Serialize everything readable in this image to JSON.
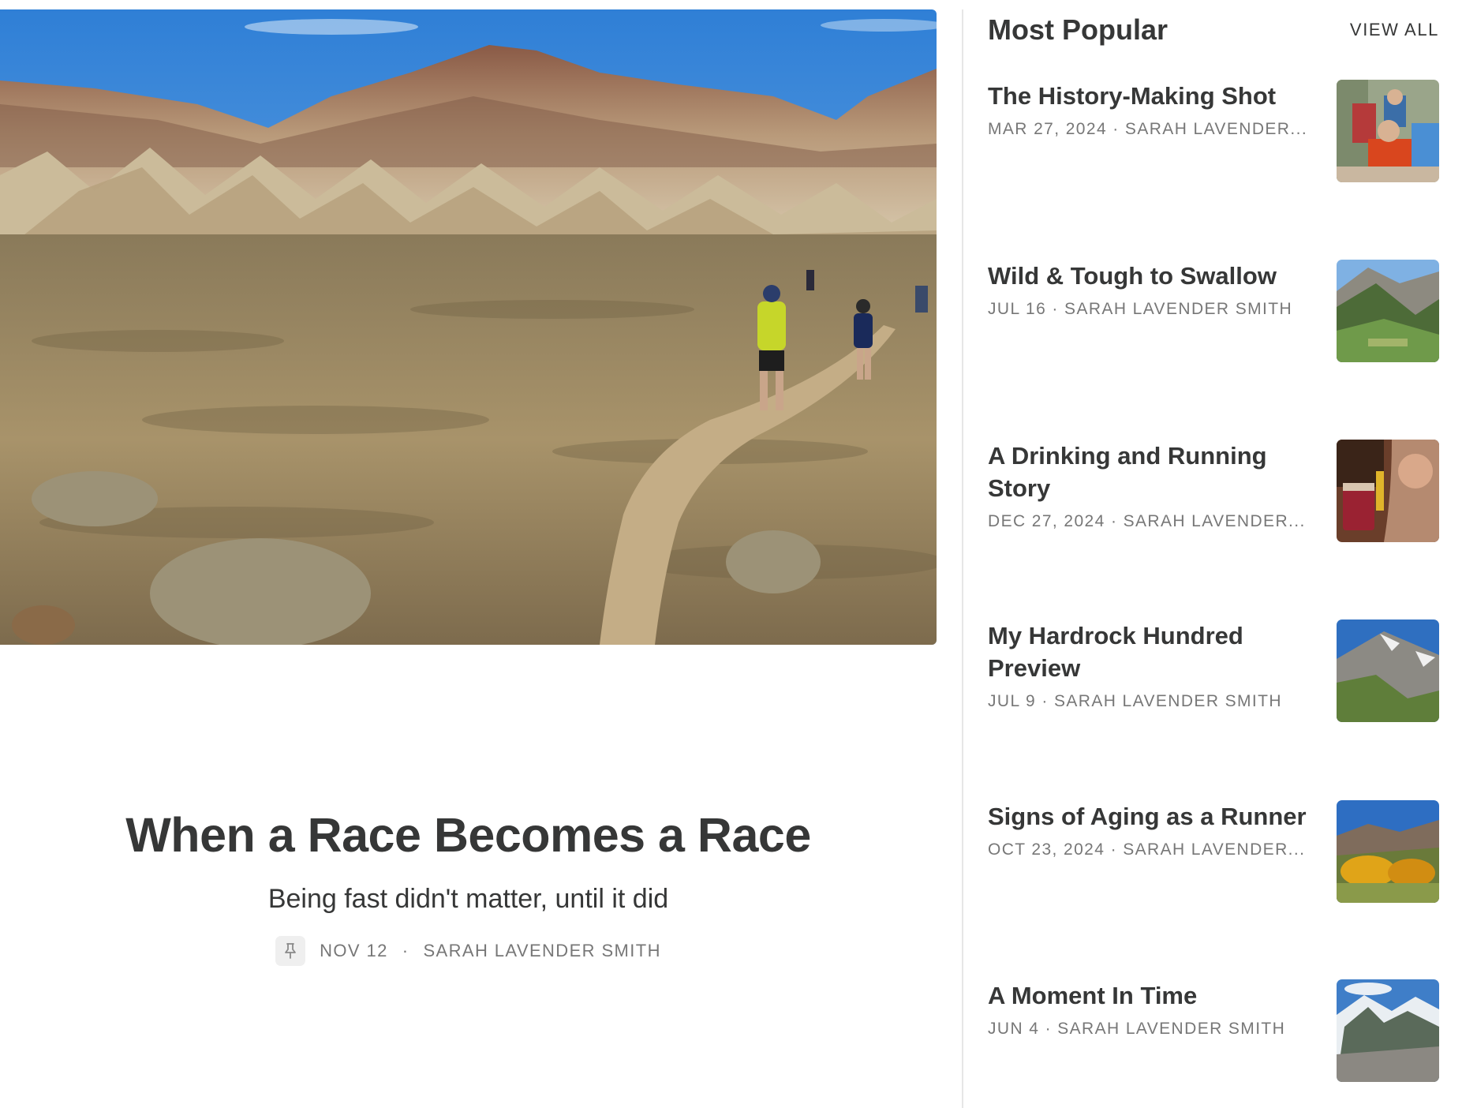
{
  "featured": {
    "title": "When a Race Becomes a Race",
    "subtitle": "Being fast didn't matter, until it did",
    "date": "NOV 12",
    "author": "SARAH LAVENDER SMITH",
    "separator": "·",
    "pin_icon": "pin-icon"
  },
  "sidebar": {
    "heading": "Most Popular",
    "view_all": "VIEW ALL",
    "items": [
      {
        "title": "The History-Making Shot",
        "date": "MAR 27, 2024",
        "author": "SARAH LAVENDER..."
      },
      {
        "title": "Wild & Tough to Swallow",
        "date": "JUL 16",
        "author": "SARAH LAVENDER SMITH"
      },
      {
        "title": "A Drinking and Running Story",
        "date": "DEC 27, 2024",
        "author": "SARAH LAVENDER..."
      },
      {
        "title": "My Hardrock Hundred Preview",
        "date": "JUL 9",
        "author": "SARAH LAVENDER SMITH"
      },
      {
        "title": "Signs of Aging as a Runner",
        "date": "OCT 23, 2024",
        "author": "SARAH LAVENDER..."
      },
      {
        "title": "A Moment In Time",
        "date": "JUN 4",
        "author": "SARAH LAVENDER SMITH"
      }
    ]
  },
  "colors": {
    "text": "#363737",
    "muted": "#777777",
    "divider": "#e6e6e6",
    "sky": "#4a8fd4"
  }
}
